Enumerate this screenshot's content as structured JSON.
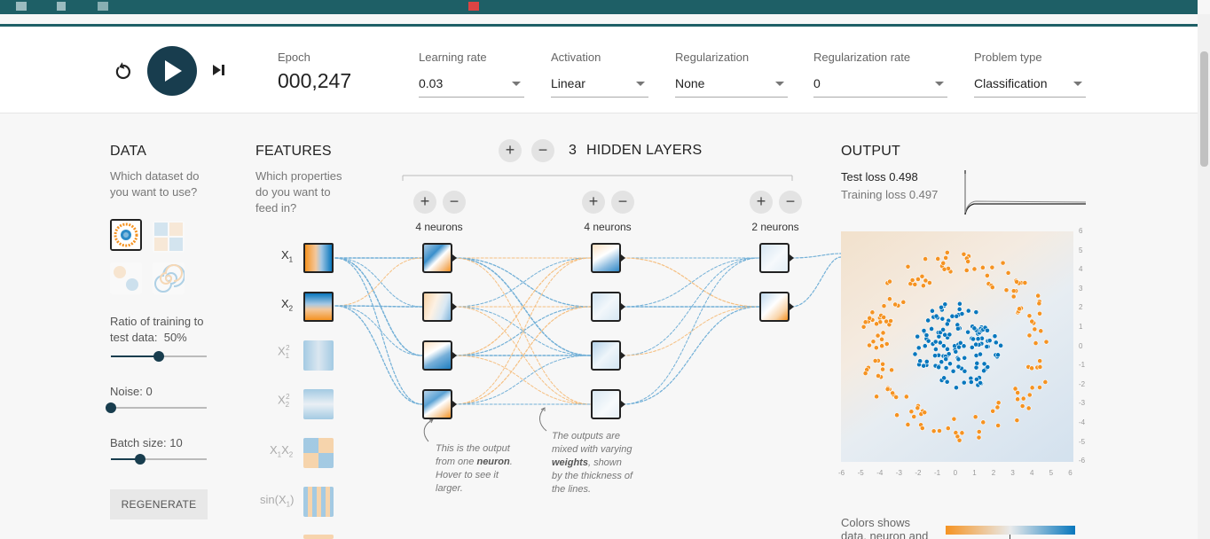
{
  "colors": {
    "accent": "#183d4e",
    "orange": "#f59322",
    "blue": "#0877bd",
    "browser": "#1e5f66"
  },
  "controls": {
    "epoch_label": "Epoch",
    "epoch_value": "000,247",
    "learning_rate": {
      "label": "Learning rate",
      "value": "0.03"
    },
    "activation": {
      "label": "Activation",
      "value": "Linear"
    },
    "regularization": {
      "label": "Regularization",
      "value": "None"
    },
    "regularization_rate": {
      "label": "Regularization rate",
      "value": "0"
    },
    "problem_type": {
      "label": "Problem type",
      "value": "Classification"
    }
  },
  "data": {
    "heading": "DATA",
    "question_line1": "Which dataset do",
    "question_line2": "you want to use?",
    "ratio_label": "Ratio of training to",
    "ratio_label2": "test data:",
    "ratio_value": "50%",
    "ratio_fraction": 0.5,
    "noise_label": "Noise:",
    "noise_value": "0",
    "batch_label": "Batch size:",
    "batch_value": "10",
    "regenerate": "REGENERATE"
  },
  "features": {
    "heading": "FEATURES",
    "question_line1": "Which properties",
    "question_line2": "do you want to",
    "question_line3": "feed in?",
    "items": [
      {
        "label": "X1",
        "active": true
      },
      {
        "label": "X2",
        "active": true
      },
      {
        "label": "X1^2",
        "active": false
      },
      {
        "label": "X2^2",
        "active": false
      },
      {
        "label": "X1X2",
        "active": false
      },
      {
        "label": "sin(X1)",
        "active": false
      }
    ]
  },
  "hidden": {
    "count": "3",
    "label": "HIDDEN LAYERS",
    "layers": [
      {
        "neurons_label": "4 neurons"
      },
      {
        "neurons_label": "4 neurons"
      },
      {
        "neurons_label": "2 neurons"
      }
    ],
    "callout1": [
      "This is the output",
      "from one ",
      "neuron",
      ".",
      "Hover to see it",
      "larger."
    ],
    "callout2": [
      "The outputs are",
      "mixed with varying",
      "weights",
      ", shown",
      "by the thickness of",
      "the lines."
    ]
  },
  "output": {
    "heading": "OUTPUT",
    "test_loss_label": "Test loss",
    "test_loss_value": "0.498",
    "training_loss_label": "Training loss",
    "training_loss_value": "0.497",
    "y_ticks": [
      "6",
      "5",
      "4",
      "3",
      "2",
      "1",
      "0",
      "-1",
      "-2",
      "-3",
      "-4",
      "-5",
      "-6"
    ],
    "x_ticks": [
      "-6",
      "-5",
      "-4",
      "-3",
      "-2",
      "-1",
      "0",
      "1",
      "2",
      "3",
      "4",
      "5",
      "6"
    ],
    "colors_label_line1": "Colors shows",
    "colors_label_line2": "data, neuron and"
  }
}
